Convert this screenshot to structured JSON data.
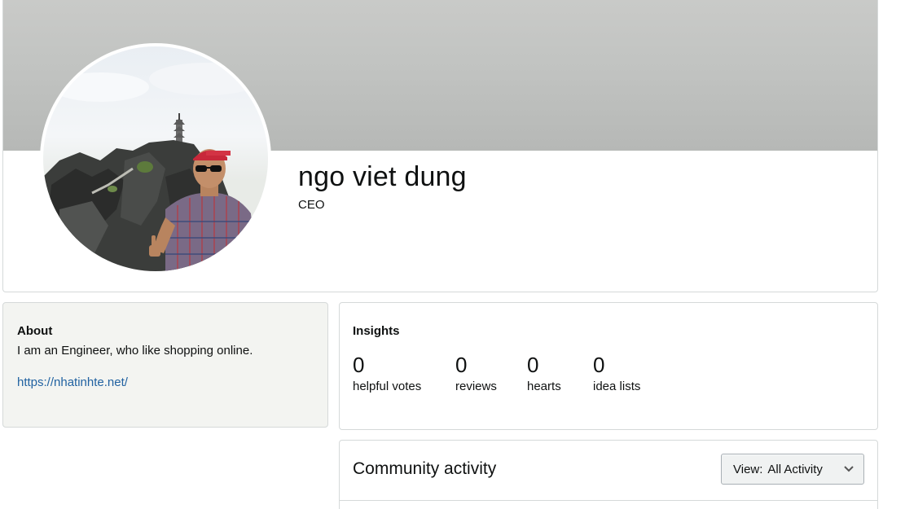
{
  "profile": {
    "name": "ngo viet dung",
    "title": "CEO",
    "avatar_icon": "profile-photo"
  },
  "about": {
    "heading": "About",
    "text": "I am an Engineer, who like shopping online.",
    "link": "https://nhatinhte.net/"
  },
  "insights": {
    "heading": "Insights",
    "stats": [
      {
        "value": "0",
        "label": "helpful votes"
      },
      {
        "value": "0",
        "label": "reviews"
      },
      {
        "value": "0",
        "label": "hearts"
      },
      {
        "value": "0",
        "label": "idea lists"
      }
    ]
  },
  "community": {
    "heading": "Community activity",
    "view_label": "View:",
    "view_value": "All Activity",
    "dropdown_icon": "chevron-down-icon"
  },
  "colors": {
    "link": "#2162a1",
    "about_bg": "#f3f4f1",
    "border": "#d5d9d9",
    "banner": "#c2c4c2"
  }
}
